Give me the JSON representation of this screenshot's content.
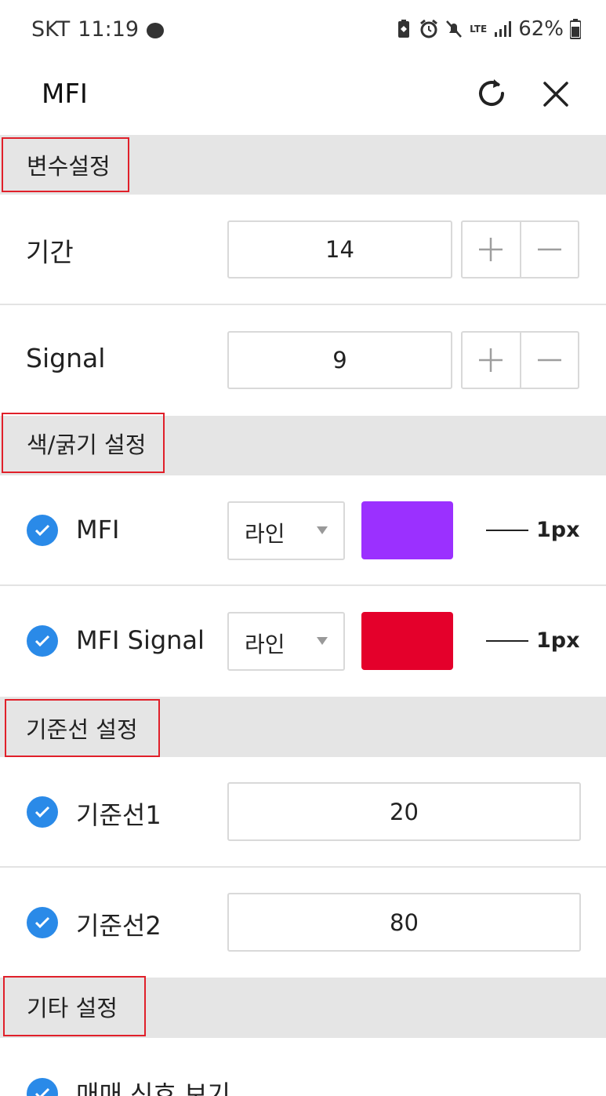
{
  "status_bar": {
    "carrier": "SKT",
    "time": "11:19",
    "network": "LTE",
    "battery": "62%"
  },
  "header": {
    "title": "MFI",
    "refresh_icon": "refresh-icon",
    "close_icon": "close-icon"
  },
  "sections": {
    "variables": "변수설정",
    "color_width": "색/굵기 설정",
    "baseline": "기준선 설정",
    "other": "기타 설정"
  },
  "variables": {
    "period": {
      "label": "기간",
      "value": "14"
    },
    "signal": {
      "label": "Signal",
      "value": "9"
    }
  },
  "colors": {
    "mfi": {
      "label": "MFI",
      "checked": true,
      "style": "라인",
      "color": "#9b30ff",
      "thickness": "1px"
    },
    "mfi_signal": {
      "label": "MFI Signal",
      "checked": true,
      "style": "라인",
      "color": "#e4002b",
      "thickness": "1px"
    }
  },
  "baselines": {
    "line1": {
      "label": "기준선1",
      "checked": true,
      "value": "20"
    },
    "line2": {
      "label": "기준선2",
      "checked": true,
      "value": "80"
    }
  },
  "other": {
    "signal_view": {
      "label": "매매 신호 보기",
      "checked": true
    }
  },
  "accent_color": "#2a8ae8",
  "highlight_color": "#e0202a"
}
